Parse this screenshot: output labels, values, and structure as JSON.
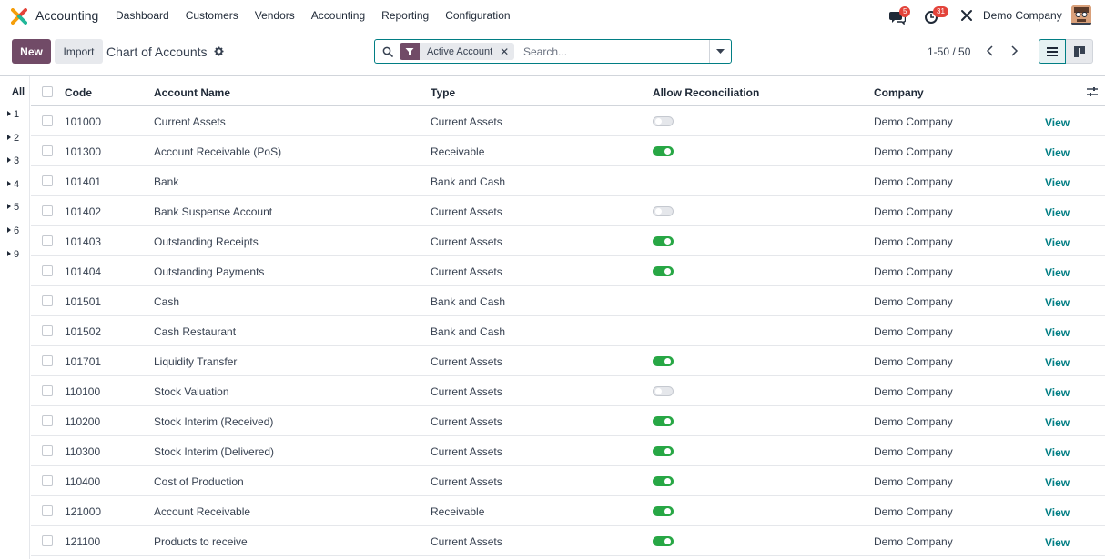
{
  "navbar": {
    "app_name": "Accounting",
    "menu": [
      "Dashboard",
      "Customers",
      "Vendors",
      "Accounting",
      "Reporting",
      "Configuration"
    ],
    "messages_badge": "5",
    "activities_badge": "31",
    "company": "Demo Company"
  },
  "control": {
    "new_label": "New",
    "import_label": "Import",
    "title": "Chart of Accounts",
    "facet_label": "Active Account",
    "search_placeholder": "Search...",
    "pager": "1-50 / 50"
  },
  "left_panel": {
    "all_label": "All",
    "groups": [
      "1",
      "2",
      "3",
      "4",
      "5",
      "6",
      "9"
    ]
  },
  "table": {
    "headers": {
      "code": "Code",
      "name": "Account Name",
      "type": "Type",
      "reconcile": "Allow Reconciliation",
      "company": "Company"
    },
    "view_label": "View",
    "rows": [
      {
        "code": "101000",
        "name": "Current Assets",
        "type": "Current Assets",
        "reconcile": "off",
        "company": "Demo Company"
      },
      {
        "code": "101300",
        "name": "Account Receivable (PoS)",
        "type": "Receivable",
        "reconcile": "on",
        "company": "Demo Company"
      },
      {
        "code": "101401",
        "name": "Bank",
        "type": "Bank and Cash",
        "reconcile": "none",
        "company": "Demo Company"
      },
      {
        "code": "101402",
        "name": "Bank Suspense Account",
        "type": "Current Assets",
        "reconcile": "off",
        "company": "Demo Company"
      },
      {
        "code": "101403",
        "name": "Outstanding Receipts",
        "type": "Current Assets",
        "reconcile": "on",
        "company": "Demo Company"
      },
      {
        "code": "101404",
        "name": "Outstanding Payments",
        "type": "Current Assets",
        "reconcile": "on",
        "company": "Demo Company"
      },
      {
        "code": "101501",
        "name": "Cash",
        "type": "Bank and Cash",
        "reconcile": "none",
        "company": "Demo Company"
      },
      {
        "code": "101502",
        "name": "Cash Restaurant",
        "type": "Bank and Cash",
        "reconcile": "none",
        "company": "Demo Company"
      },
      {
        "code": "101701",
        "name": "Liquidity Transfer",
        "type": "Current Assets",
        "reconcile": "on",
        "company": "Demo Company"
      },
      {
        "code": "110100",
        "name": "Stock Valuation",
        "type": "Current Assets",
        "reconcile": "off",
        "company": "Demo Company"
      },
      {
        "code": "110200",
        "name": "Stock Interim (Received)",
        "type": "Current Assets",
        "reconcile": "on",
        "company": "Demo Company"
      },
      {
        "code": "110300",
        "name": "Stock Interim (Delivered)",
        "type": "Current Assets",
        "reconcile": "on",
        "company": "Demo Company"
      },
      {
        "code": "110400",
        "name": "Cost of Production",
        "type": "Current Assets",
        "reconcile": "on",
        "company": "Demo Company"
      },
      {
        "code": "121000",
        "name": "Account Receivable",
        "type": "Receivable",
        "reconcile": "on",
        "company": "Demo Company"
      },
      {
        "code": "121100",
        "name": "Products to receive",
        "type": "Current Assets",
        "reconcile": "on",
        "company": "Demo Company"
      }
    ]
  },
  "colors": {
    "primary": "#714b67",
    "link": "#017e84",
    "toggle_on": "#28a745"
  }
}
